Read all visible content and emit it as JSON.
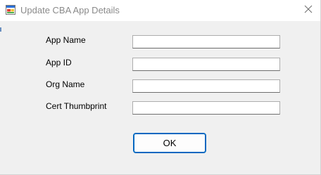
{
  "window": {
    "title": "Update CBA App Details",
    "icon": "windows-form-icon",
    "close_icon": "close-x-icon"
  },
  "fields": [
    {
      "label": "App Name",
      "value": "",
      "placeholder": ""
    },
    {
      "label": "App ID",
      "value": "",
      "placeholder": ""
    },
    {
      "label": "Org Name",
      "value": "",
      "placeholder": ""
    },
    {
      "label": "Cert Thumbprint",
      "value": "",
      "placeholder": ""
    }
  ],
  "buttons": {
    "ok_label": "OK"
  },
  "colors": {
    "accent": "#0067c0",
    "title_text": "#8a8a8a",
    "window_bg": "#f0f0f0"
  }
}
